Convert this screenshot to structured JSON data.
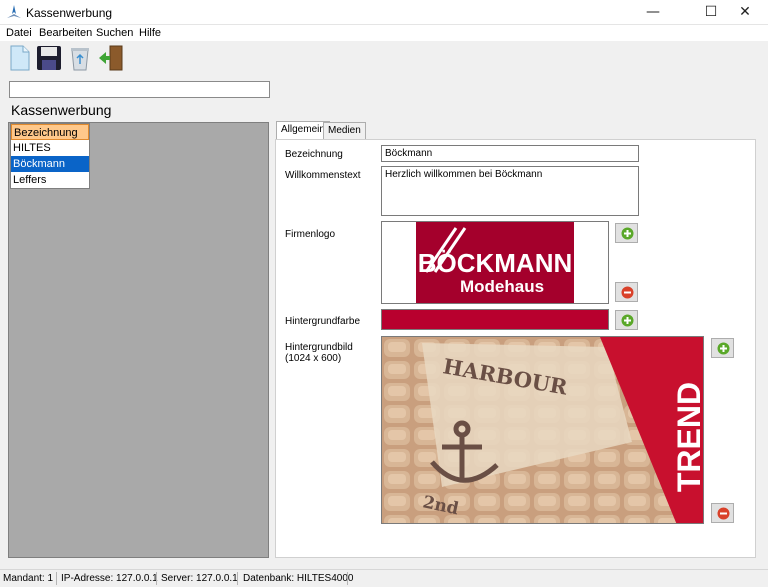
{
  "window": {
    "title": "Kassenwerbung"
  },
  "menu": {
    "items": [
      "Datei",
      "Bearbeiten",
      "Suchen",
      "Hilfe"
    ]
  },
  "search": {
    "value": ""
  },
  "panel": {
    "heading": "Kassenwerbung"
  },
  "list": {
    "header": "Bezeichnung",
    "rows": [
      "HILTES",
      "Böckmann",
      "Leffers"
    ],
    "selected": "Böckmann"
  },
  "tabs": [
    "Allgemein",
    "Medien"
  ],
  "form": {
    "bezeichnung_label": "Bezeichnung",
    "bezeichnung_value": "Böckmann",
    "willkommen_label": "Willkommenstext",
    "willkommen_value": "Herzlich willkommen bei Böckmann",
    "firmenlogo_label": "Firmenlogo",
    "logo_text_1": "BÖCKMANN",
    "logo_text_2": "Modehaus",
    "hintergrundfarbe_label": "Hintergrundfarbe",
    "hintergrundfarbe_value": "#b8002e",
    "hintergrundbild_label": "Hintergrundbild",
    "hintergrundbild_size": "(1024 x 600)",
    "bg_text_harbour": "HARBOUR",
    "bg_text_trend": "TREND",
    "bg_text_2nd": "2nd"
  },
  "colors": {
    "logo_bg": "#a4002c",
    "accent_red": "#c8102e",
    "add_green": "#5aa829",
    "remove_red": "#d9412a"
  },
  "status": {
    "mandant": "Mandant: 1",
    "ip": "IP-Adresse: 127.0.0.1",
    "server": "Server: 127.0.0.1",
    "datenbank": "Datenbank: HILTES4000"
  }
}
